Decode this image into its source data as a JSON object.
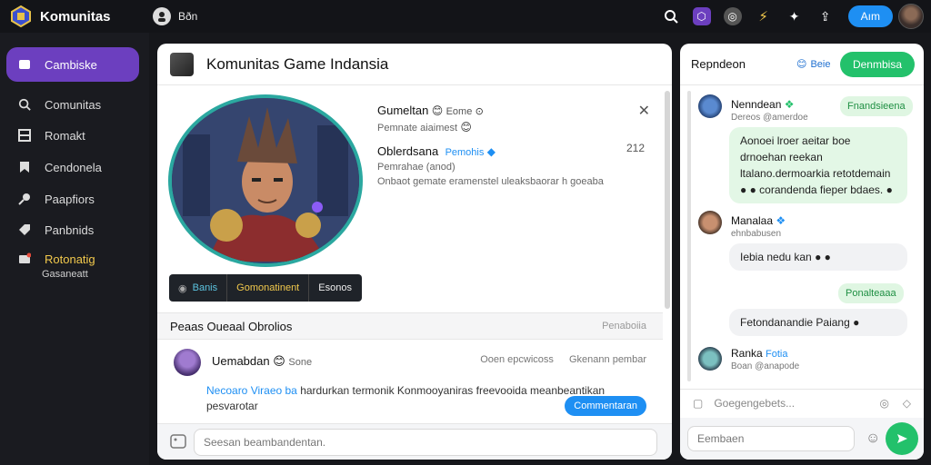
{
  "topbar": {
    "brand": "Komunitas",
    "user_label": "Bðn",
    "login_button": "Aım",
    "icons": [
      "search-icon",
      "shield-icon",
      "globe-icon",
      "bolt-icon",
      "gamepad-icon",
      "upload-icon",
      "avatar"
    ]
  },
  "sidebar": {
    "active": "Cambiske",
    "items": [
      {
        "label": "Comunitas",
        "icon": "search-icon"
      },
      {
        "label": "Romakt",
        "icon": "grid-icon"
      },
      {
        "label": "Cendonela",
        "icon": "bookmark-icon"
      },
      {
        "label": "Paapfiors",
        "icon": "key-icon"
      },
      {
        "label": "Panbnids",
        "icon": "tag-icon"
      },
      {
        "label": "Rotonatig",
        "icon": "folder-icon"
      }
    ],
    "sub_label": "Gasaneatt"
  },
  "main": {
    "title": "Komunitas Game Indansia",
    "stats": [
      "Banis",
      "Gomonatinent",
      "Esonos"
    ],
    "info": {
      "line1_name": "Gumeltan",
      "line1_tag": "Eome",
      "line2": "Pemnate aiaimest",
      "line3_name": "Oblerdsana",
      "line3_tag": "Pemohis",
      "line4": "Pemrahae (anod)",
      "line5": "Onbaot gemate eramenstel uleaksbaorar h goeaba",
      "count": "212"
    },
    "section_title": "Peaas Oueaal Obrolios",
    "section_right": "Penaboiia",
    "post": {
      "author": "Uemabdan",
      "badge": "Sone",
      "meta_left": "Ooen epcwicoss",
      "meta_right": "Gkenann pembar",
      "body_highlight": "Necoaro Viraeo ba",
      "body": "hardurkan termonik Konmooyaniras freevooida meanbeantikan pesvarotar",
      "cta": "Commentaran"
    },
    "composer_placeholder": "Seesan beambandentan."
  },
  "chat": {
    "title": "Repndeon",
    "status": "Beie",
    "action": "Denmbisa",
    "messages": [
      {
        "name": "Nenndean",
        "sub": "Dereos @amerdoe",
        "pill": "Fnandsieena"
      },
      {
        "text": "Aonoei lroer aeitar boe drnoehan reekan ltalano.dermoarkia retotdemain ● ● corandenda fieper bdaes. ●"
      },
      {
        "name": "Manalaa",
        "sub": "ehnbabusen"
      },
      {
        "text": "Iebia nedu kan ● ●"
      },
      {
        "pill": "Ponalteaaa"
      },
      {
        "text": "Fetondanandie Paiang ●"
      },
      {
        "name": "Ranka",
        "tag": "Fotia",
        "sub": "Boan @anapode"
      }
    ],
    "tools_placeholder": "Goegengebets...",
    "compose_placeholder": "Eembaen"
  },
  "colors": {
    "accent_purple": "#6c3fbf",
    "accent_blue": "#1e8ff3",
    "accent_green": "#23c16b",
    "sidebar_bg": "#1a1b20",
    "topbar_bg": "#131418"
  }
}
